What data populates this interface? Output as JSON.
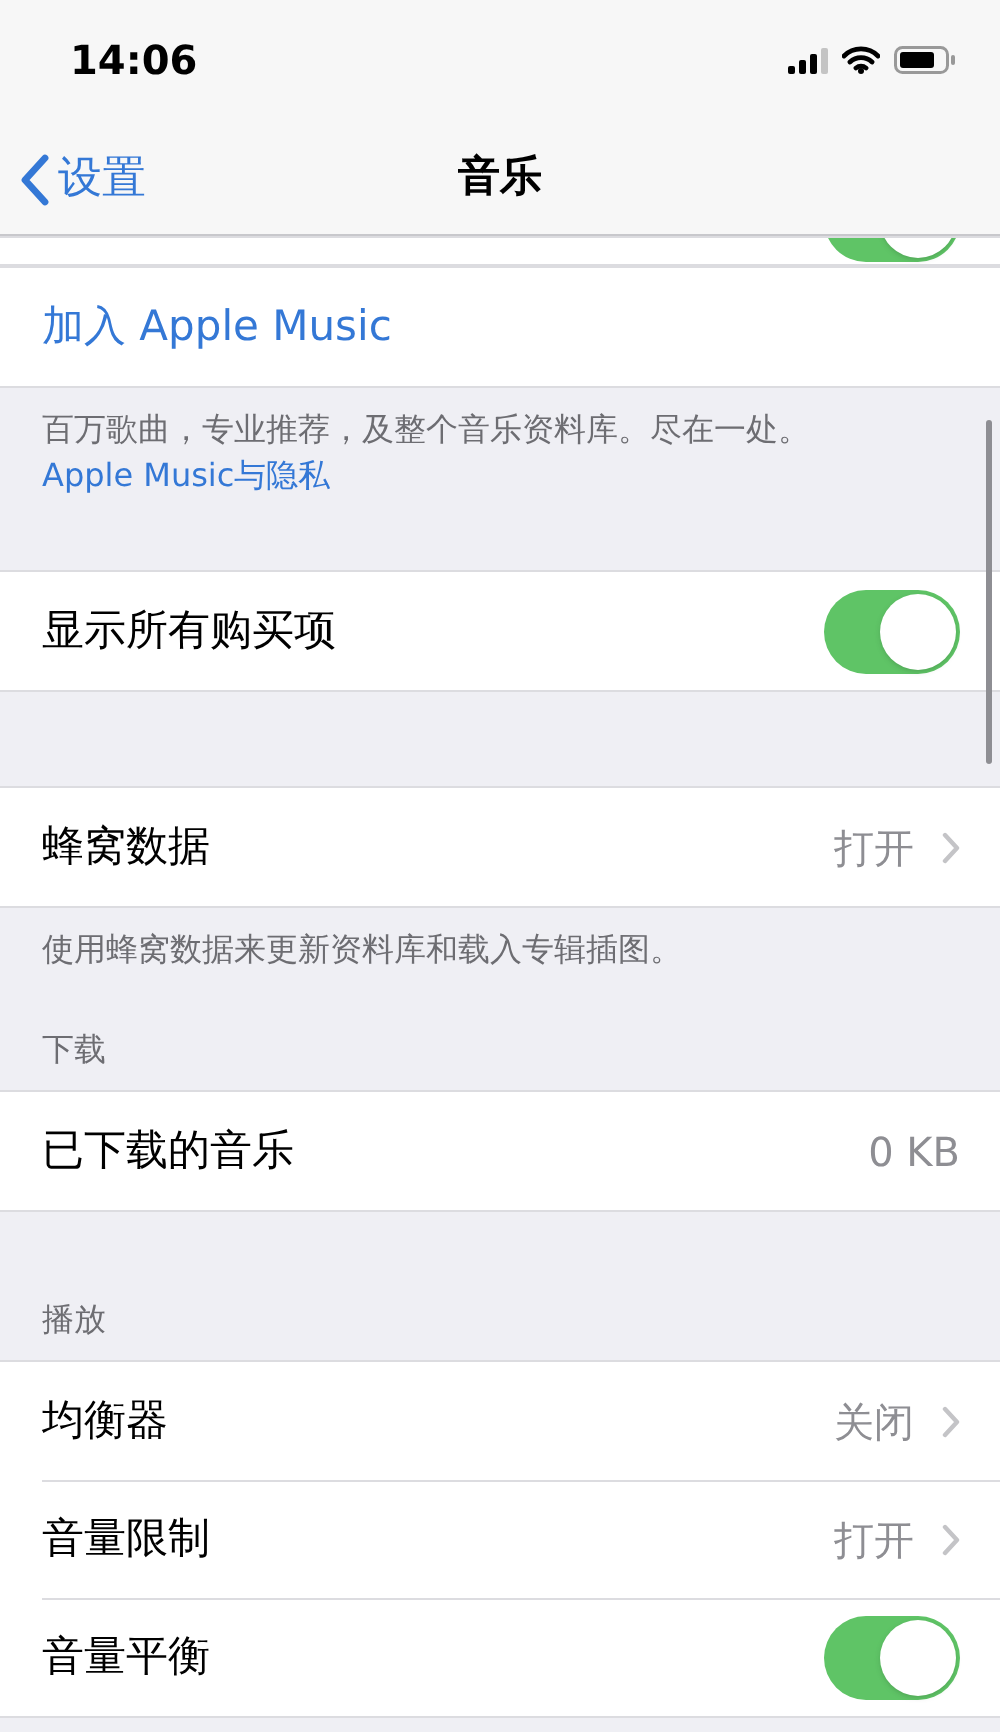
{
  "status_bar": {
    "time": "14:06"
  },
  "nav": {
    "back": "设置",
    "title": "音乐"
  },
  "sections": [
    {
      "rows": [
        {
          "kind": "peek",
          "on": true
        }
      ]
    },
    {
      "rows": [
        {
          "kind": "link",
          "label": "加入 Apple Music"
        }
      ],
      "footer": {
        "text": "百万歌曲，专业推荐，及整个音乐资料库。尽在一处。",
        "link": "Apple Music与隐私"
      }
    },
    {
      "rows": [
        {
          "kind": "toggle",
          "label": "显示所有购买项",
          "on": true
        }
      ]
    },
    {
      "rows": [
        {
          "kind": "disclosure",
          "label": "蜂窝数据",
          "value": "打开"
        }
      ],
      "footer": {
        "text": "使用蜂窝数据来更新资料库和载入专辑插图。"
      }
    },
    {
      "header": "下载",
      "rows": [
        {
          "kind": "value",
          "label": "已下载的音乐",
          "value": "0 KB"
        }
      ]
    },
    {
      "header": "播放",
      "rows": [
        {
          "kind": "disclosure",
          "label": "均衡器",
          "value": "关闭"
        },
        {
          "kind": "disclosure",
          "label": "音量限制",
          "value": "打开"
        },
        {
          "kind": "toggle",
          "label": "音量平衡",
          "on": true
        }
      ]
    }
  ]
}
